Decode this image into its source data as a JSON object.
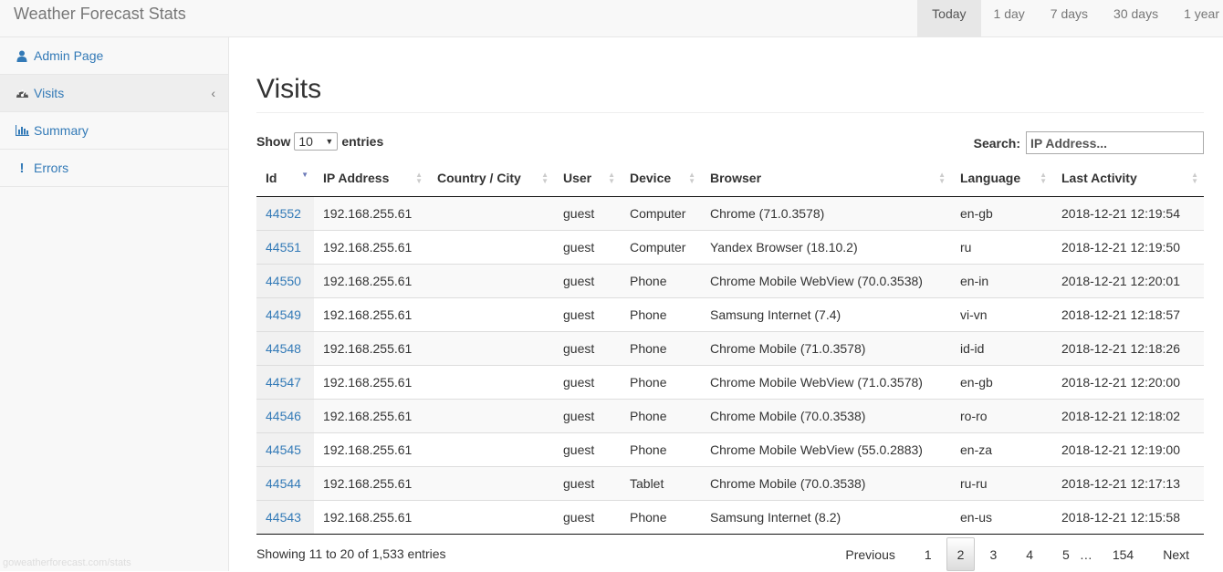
{
  "app": {
    "title": "Weather Forecast Stats"
  },
  "ranges": [
    {
      "label": "Today"
    },
    {
      "label": "1 day"
    },
    {
      "label": "7 days"
    },
    {
      "label": "30 days"
    },
    {
      "label": "1 year"
    }
  ],
  "sidebar": {
    "items": [
      {
        "label": "Admin Page",
        "icon": "user-icon"
      },
      {
        "label": "Visits",
        "icon": "dashboard-icon"
      },
      {
        "label": "Summary",
        "icon": "bar-chart-icon"
      },
      {
        "label": "Errors",
        "icon": "exclamation-icon"
      }
    ],
    "footer_url": "goweatherforecast.com/stats"
  },
  "main": {
    "title": "Visits",
    "length": {
      "show": "Show",
      "value": "10",
      "entries": "entries"
    },
    "search": {
      "label": "Search:",
      "placeholder": "IP Address..."
    },
    "columns": [
      "Id",
      "IP Address",
      "Country / City",
      "User",
      "Device",
      "Browser",
      "Language",
      "Last Activity"
    ],
    "rows": [
      [
        "44552",
        "192.168.255.61",
        "",
        "guest",
        "Computer",
        "Chrome (71.0.3578)",
        "en-gb",
        "2018-12-21 12:19:54"
      ],
      [
        "44551",
        "192.168.255.61",
        "",
        "guest",
        "Computer",
        "Yandex Browser (18.10.2)",
        "ru",
        "2018-12-21 12:19:50"
      ],
      [
        "44550",
        "192.168.255.61",
        "",
        "guest",
        "Phone",
        "Chrome Mobile WebView (70.0.3538)",
        "en-in",
        "2018-12-21 12:20:01"
      ],
      [
        "44549",
        "192.168.255.61",
        "",
        "guest",
        "Phone",
        "Samsung Internet (7.4)",
        "vi-vn",
        "2018-12-21 12:18:57"
      ],
      [
        "44548",
        "192.168.255.61",
        "",
        "guest",
        "Phone",
        "Chrome Mobile (71.0.3578)",
        "id-id",
        "2018-12-21 12:18:26"
      ],
      [
        "44547",
        "192.168.255.61",
        "",
        "guest",
        "Phone",
        "Chrome Mobile WebView (71.0.3578)",
        "en-gb",
        "2018-12-21 12:20:00"
      ],
      [
        "44546",
        "192.168.255.61",
        "",
        "guest",
        "Phone",
        "Chrome Mobile (70.0.3538)",
        "ro-ro",
        "2018-12-21 12:18:02"
      ],
      [
        "44545",
        "192.168.255.61",
        "",
        "guest",
        "Phone",
        "Chrome Mobile WebView (55.0.2883)",
        "en-za",
        "2018-12-21 12:19:00"
      ],
      [
        "44544",
        "192.168.255.61",
        "",
        "guest",
        "Tablet",
        "Chrome Mobile (70.0.3538)",
        "ru-ru",
        "2018-12-21 12:17:13"
      ],
      [
        "44543",
        "192.168.255.61",
        "",
        "guest",
        "Phone",
        "Samsung Internet (8.2)",
        "en-us",
        "2018-12-21 12:15:58"
      ]
    ],
    "info": "Showing 11 to 20 of 1,533 entries",
    "pager": {
      "previous": "Previous",
      "pages": [
        "1",
        "2",
        "3",
        "4",
        "5"
      ],
      "current": "2",
      "ellipsis": "…",
      "last": "154",
      "next": "Next"
    }
  },
  "colors": {
    "link": "#337ab7",
    "navbar_bg": "#f8f8f8",
    "active_range_bg": "#e7e7e7"
  }
}
